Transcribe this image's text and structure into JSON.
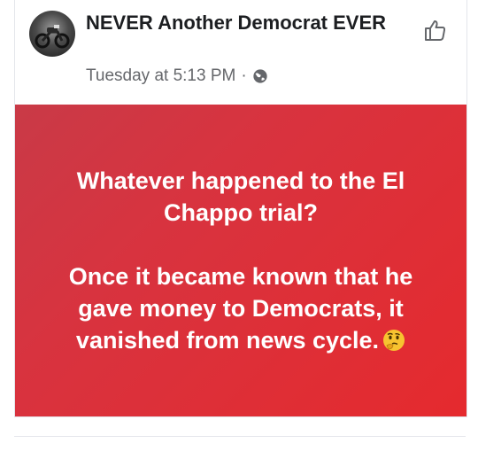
{
  "post": {
    "author": "NEVER Another Democrat EVER",
    "timestamp": "Tuesday at 5:13 PM",
    "separator": "·",
    "privacy_icon": "globe-icon",
    "action_icon": "like-icon",
    "banner": {
      "line1": "Whatever happened to the El Chappo trial?",
      "line2": "Once it became known that he gave money to Democrats, it vanished from news cycle.",
      "emoji": "thinking-face-emoji",
      "background_start": "#c93a47",
      "background_end": "#e52a2e",
      "text_color": "#ffffff"
    }
  }
}
